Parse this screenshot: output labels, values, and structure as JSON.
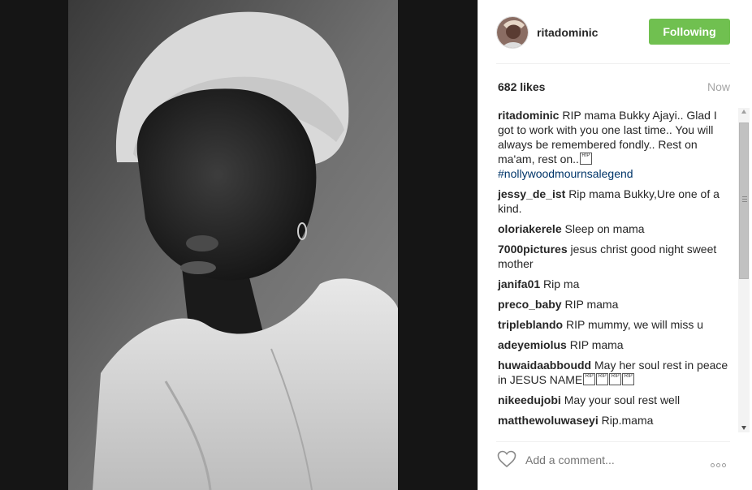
{
  "post": {
    "username": "ritadominic",
    "follow_label": "Following",
    "likes": "682 likes",
    "time": "Now",
    "follow_color": "#70c050"
  },
  "comments": [
    {
      "user": "ritadominic",
      "text": "RIP mama Bukky Ajayi.. Glad I got to work with you one last time.. You will always be remembered fondly.. Rest on ma'am, rest on..",
      "emoji": "RIP",
      "hashtag": "#nollywoodmournsalegend"
    },
    {
      "user": "jessy_de_ist",
      "text": "Rip mama Bukky,Ure one of a kind."
    },
    {
      "user": "oloriakerele",
      "text": "Sleep on mama"
    },
    {
      "user": "7000pictures",
      "text": "jesus christ good night sweet mother"
    },
    {
      "user": "janifa01",
      "text": "Rip ma"
    },
    {
      "user": "preco_baby",
      "text": "RIP mama"
    },
    {
      "user": "tripleblando",
      "text": "RIP mummy, we will miss u"
    },
    {
      "user": "adeyemiolus",
      "text": "RIP mama"
    },
    {
      "user": "huwaidaabboudd",
      "text": "May her soul rest in peace in JESUS NAME",
      "emoji": "RIP"
    },
    {
      "user": "nikeedujobi",
      "text": "May your soul rest well"
    },
    {
      "user": "matthewoluwaseyi",
      "text": "Rip.mama"
    }
  ],
  "comment_bar": {
    "placeholder": "Add a comment...",
    "heart_icon": "heart-outline-icon",
    "more_icon": "more-options-icon"
  }
}
